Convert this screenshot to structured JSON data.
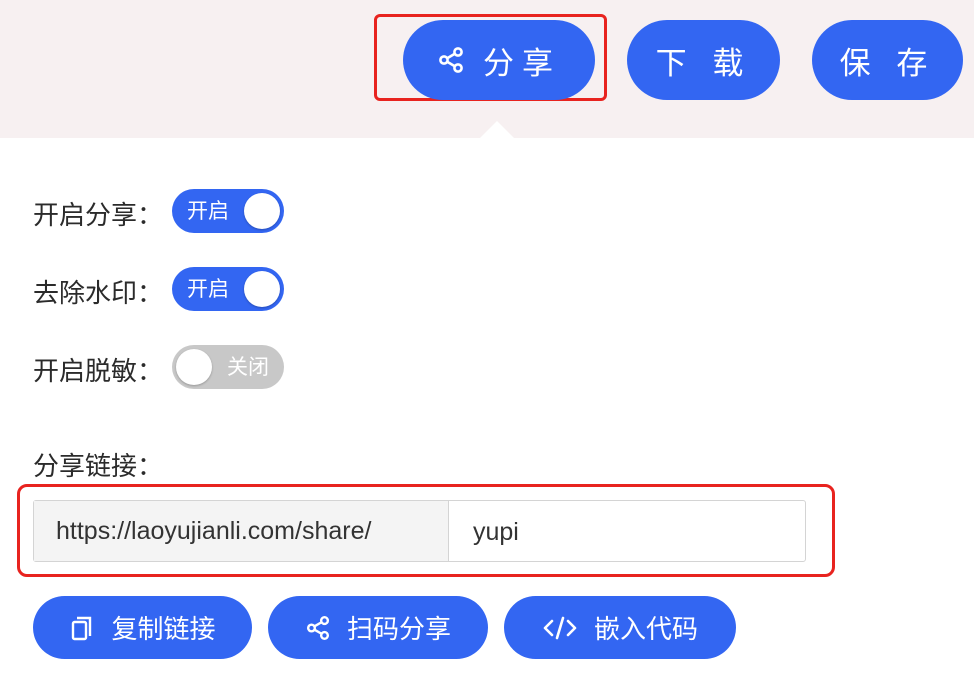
{
  "toolbar": {
    "share_label": "分享",
    "download_label": "下 载",
    "save_label": "保 存"
  },
  "settings": {
    "enable_share": {
      "label": "开启分享：",
      "state_text": "开启",
      "on": true
    },
    "remove_watermark": {
      "label": "去除水印：",
      "state_text": "开启",
      "on": true
    },
    "enable_desensitize": {
      "label": "开启脱敏：",
      "state_text": "关闭",
      "on": false
    }
  },
  "share_link": {
    "label": "分享链接：",
    "prefix": "https://laoyujianli.com/share/",
    "value": "yupi"
  },
  "actions": {
    "copy_label": "复制链接",
    "qr_label": "扫码分享",
    "embed_label": "嵌入代码"
  },
  "icons": {
    "share": "share-icon",
    "copy": "copy-icon",
    "embed": "code-icon"
  },
  "colors": {
    "primary": "#3366f2",
    "highlight": "#e8231f",
    "toggle_off": "#c8c8c8",
    "topbar_bg": "#f7f0f1"
  }
}
